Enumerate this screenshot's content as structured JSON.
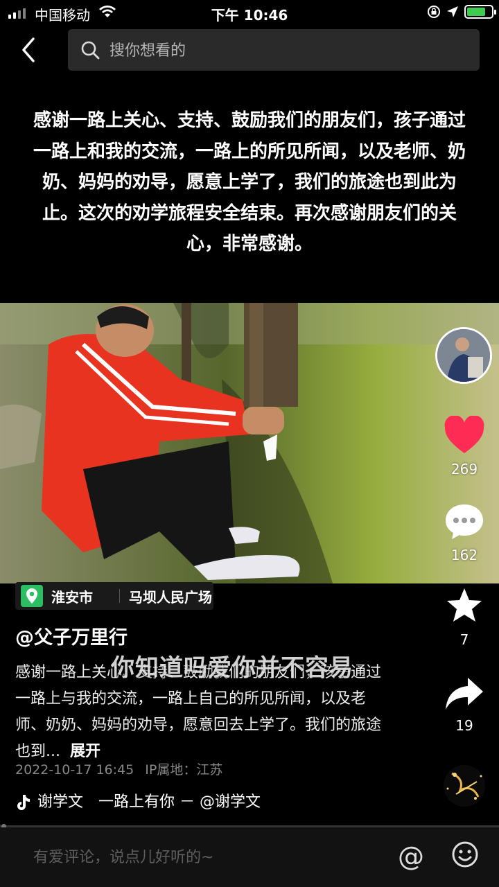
{
  "status_bar": {
    "carrier": "中国移动",
    "time": "下午 10:46"
  },
  "search": {
    "placeholder": "搜你想看的"
  },
  "overlay_headline": "感谢一路上关心、支持、鼓励我们的朋友们，孩子通过一路上和我的交流，一路上的所见所闻，以及老师、奶奶、妈妈的劝导，愿意上学了，我们的旅途也到此为止。这次的劝学旅程安全结束。再次感谢朋友们的关心，非常感谢。",
  "actions": {
    "like_count": "269",
    "comment_count": "162",
    "favorite_count": "7",
    "share_count": "19",
    "like_color": "#fe2c55"
  },
  "location": {
    "city": "淮安市",
    "place": "马坝人民广场"
  },
  "author": "@父子万里行",
  "description": "感谢一路上关心、支持、鼓励我们的朋友们，孩子通过一路上与我的交流，一路上自己的所见所闻，以及老师、奶奶、妈妈的劝导，愿意回去上学了。我们的旅途也到...",
  "expand_label": "展开",
  "video_caption": "你知道吗爱你并不容易",
  "meta": {
    "date": "2022-10-17 16:45",
    "ip": "IP属地：江苏"
  },
  "music": {
    "text": "谢学文　一路上有你 － @谢学文"
  },
  "comment": {
    "placeholder": "有爱评论，说点儿好听的~",
    "at_symbol": "@"
  }
}
